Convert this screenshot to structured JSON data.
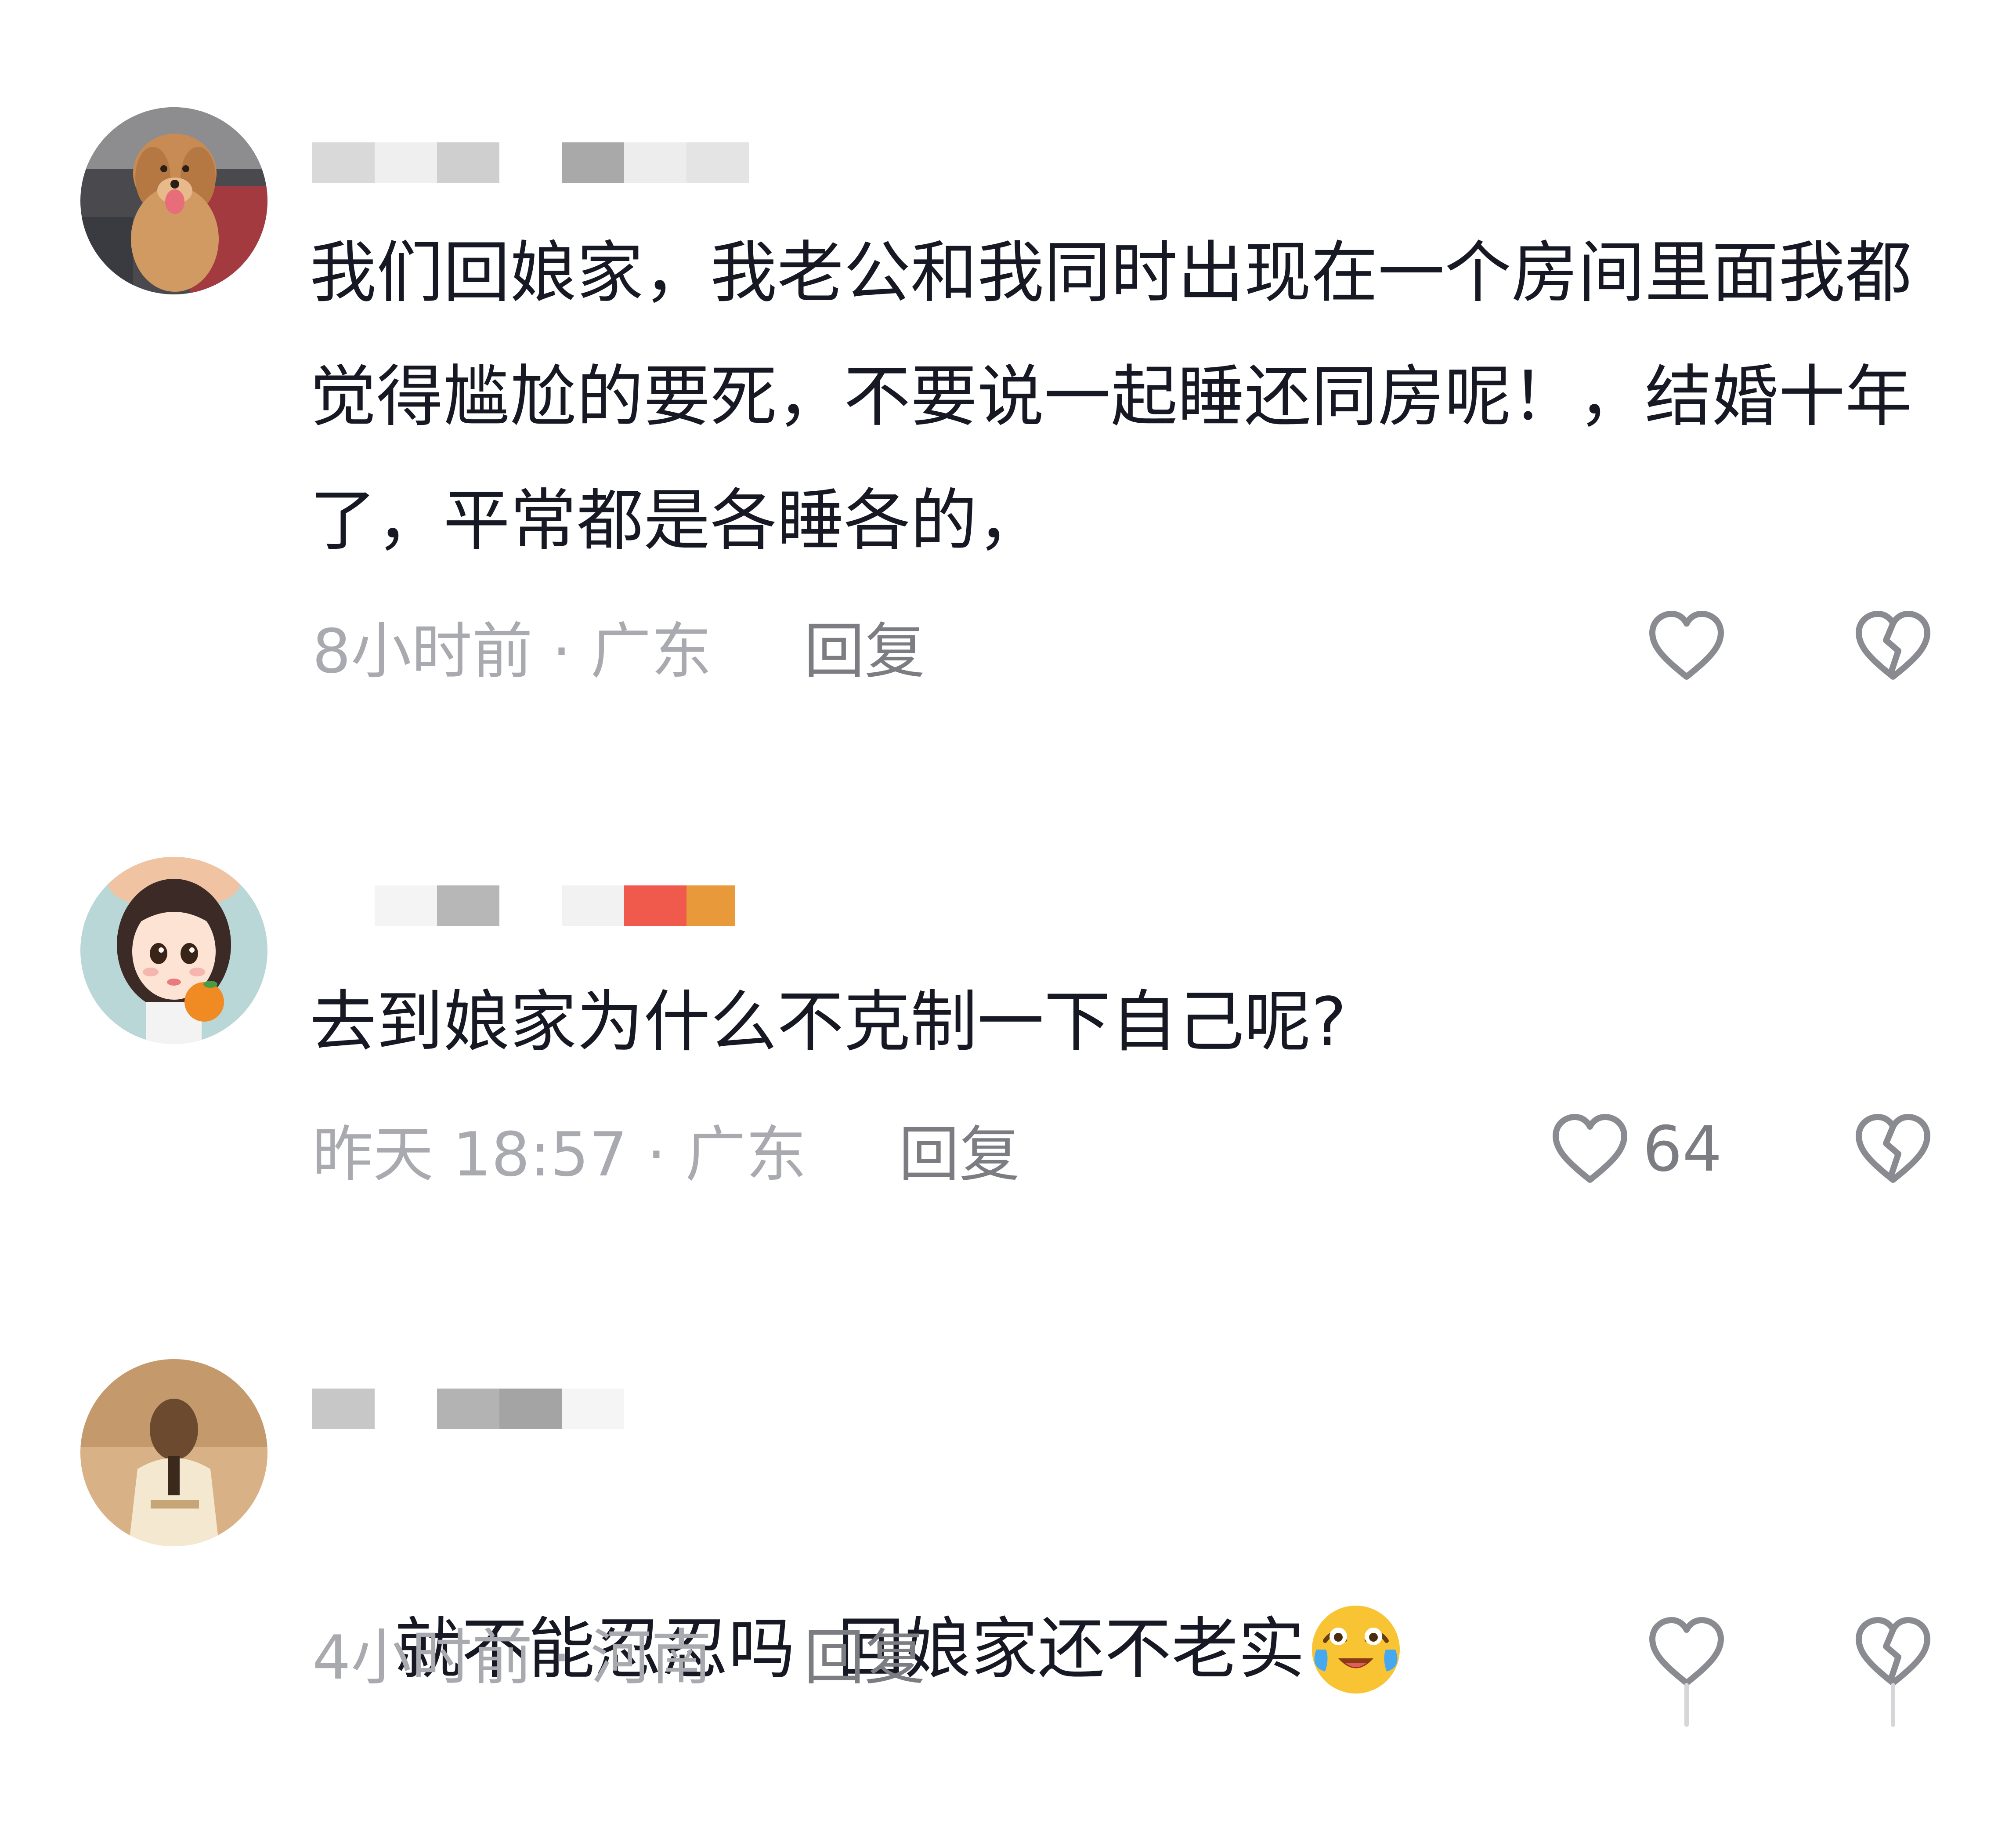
{
  "comments": [
    {
      "text": "我们回娘家，我老公和我同时出现在一个房间里面我都觉得尴尬的要死，不要说一起睡还同房呢！，结婚十年了，平常都是各睡各的，",
      "time_location": "8小时前 · 广东",
      "reply_label": "回复",
      "like_count": "",
      "avatar": "puppy-photo",
      "username_blur_colors": [
        "#d9d9d9",
        "#efefef",
        "#cfcfcf",
        "#ffffff",
        "#a9a9a9",
        "#ededed",
        "#e4e4e4"
      ]
    },
    {
      "text": "去到娘家为什么不克制一下自己呢?",
      "time_location": "昨天 18:57 · 广东",
      "reply_label": "回复",
      "like_count": "64",
      "avatar": "cartoon-girl-with-orange",
      "username_blur_colors": [
        "#ffffff",
        "#f4f4f4",
        "#b7b7b7",
        "#ffffff",
        "#f2f2f2",
        "#f05a4d",
        "#e89a3a"
      ]
    },
    {
      "text": "就不能忍忍吗  回娘家还不老实",
      "time_location": "4小时前 · 河南",
      "reply_label": "回复",
      "like_count": "",
      "avatar": "beige-figure-photo",
      "emoji": "crying-laughing-emoji",
      "username_blur_colors": [
        "#c7c7c7",
        "#ffffff",
        "#b3b3b3",
        "#a4a4a4",
        "#f5f5f5"
      ]
    }
  ],
  "icons": {
    "like": "heart-outline-icon",
    "dislike": "broken-heart-icon"
  },
  "colors": {
    "text": "#161823",
    "meta": "#a9aab0",
    "reply": "#7c7d83",
    "icon": "#8a8b91"
  }
}
